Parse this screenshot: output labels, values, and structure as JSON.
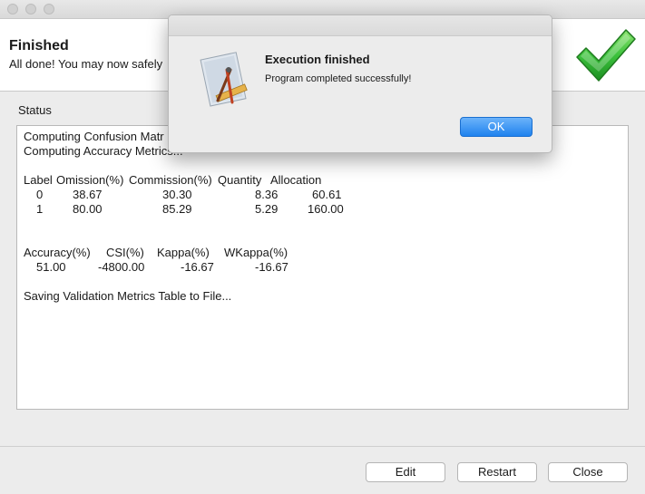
{
  "header": {
    "title": "Finished",
    "subtitle": "All done! You may now safely"
  },
  "status": {
    "label": "Status",
    "lines": [
      "Computing Confusion Matr",
      "Computing Accuracy Metrics..."
    ],
    "class_table": {
      "headers": [
        "Label",
        "Omission(%)",
        "Commission(%)",
        "Quantity",
        "Allocation"
      ],
      "rows": [
        [
          "0",
          "38.67",
          "30.30",
          "8.36",
          "60.61"
        ],
        [
          "1",
          "80.00",
          "85.29",
          "5.29",
          "160.00"
        ]
      ]
    },
    "summary_table": {
      "headers": [
        "Accuracy(%)",
        "CSI(%)",
        "Kappa(%)",
        "WKappa(%)"
      ],
      "values": [
        "51.00",
        "-4800.00",
        "-16.67",
        "-16.67"
      ]
    },
    "final_line": "Saving Validation Metrics Table to File..."
  },
  "buttons": {
    "edit": "Edit",
    "restart": "Restart",
    "close": "Close"
  },
  "dialog": {
    "title": "Execution finished",
    "message": "Program completed successfully!",
    "ok": "OK"
  },
  "colors": {
    "accent": "#1f82ee",
    "success": "#3cc23c"
  }
}
